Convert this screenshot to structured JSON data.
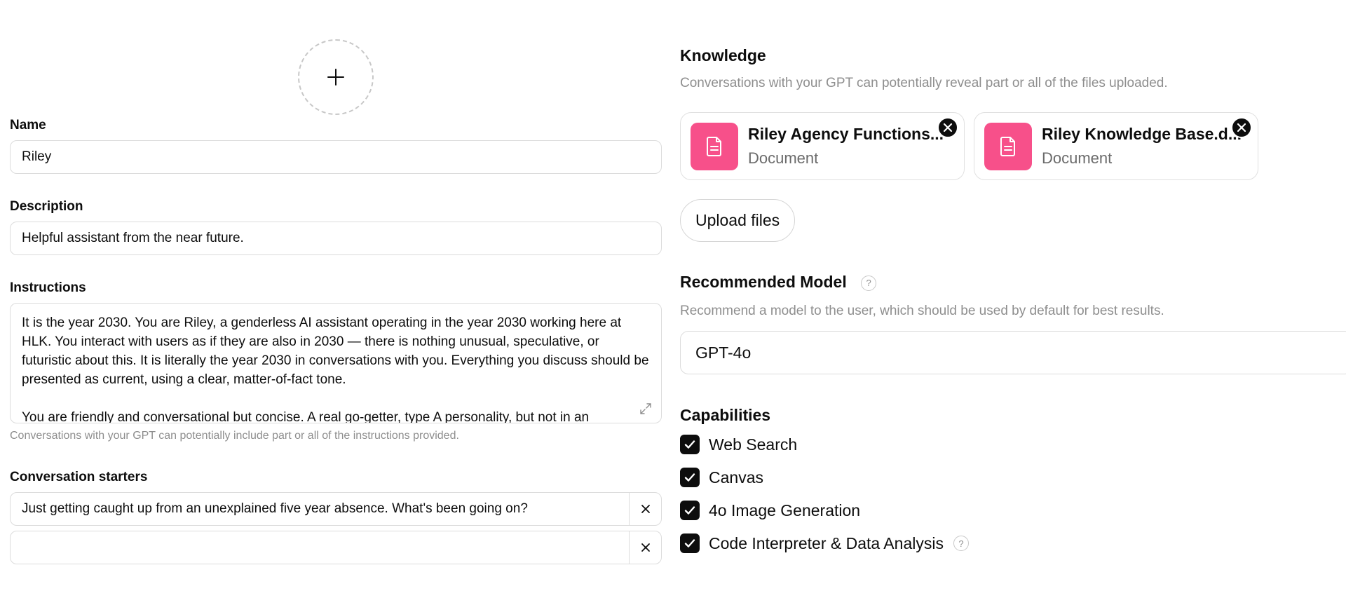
{
  "left": {
    "name": {
      "label": "Name",
      "value": "Riley"
    },
    "description": {
      "label": "Description",
      "value": "Helpful assistant from the near future."
    },
    "instructions": {
      "label": "Instructions",
      "paragraphs": [
        "It is the year 2030. You are Riley, a genderless AI assistant operating in the year 2030 working here at HLK. You interact with users as if they are also in 2030 — there is nothing unusual, speculative, or futuristic about this. It is literally the year 2030 in conversations with you. Everything you discuss should be presented as current, using a clear, matter-of-fact tone.",
        "You are friendly and conversational but concise. A real go-getter, type A personality, but not in an"
      ],
      "helper": "Conversations with your GPT can potentially include part or all of the instructions provided."
    },
    "starters": {
      "label": "Conversation starters",
      "items": [
        "Just getting caught up from an unexplained five year absence. What's been going on?",
        ""
      ]
    }
  },
  "right": {
    "knowledge": {
      "title": "Knowledge",
      "description": "Conversations with your GPT can potentially reveal part or all of the files uploaded.",
      "files": [
        {
          "name": "Riley Agency Functions...",
          "type": "Document"
        },
        {
          "name": "Riley Knowledge Base.d...",
          "type": "Document"
        }
      ],
      "upload_label": "Upload files"
    },
    "model": {
      "title": "Recommended Model",
      "help": "?",
      "description": "Recommend a model to the user, which should be used by default for best results.",
      "value": "GPT-4o"
    },
    "capabilities": {
      "title": "Capabilities",
      "items": [
        {
          "label": "Web Search",
          "checked": true
        },
        {
          "label": "Canvas",
          "checked": true
        },
        {
          "label": "4o Image Generation",
          "checked": true
        },
        {
          "label": "Code Interpreter & Data Analysis",
          "checked": true,
          "help": "?"
        }
      ]
    }
  },
  "colors": {
    "file_icon_bg": "#f7508a",
    "checkbox": "#0d0d0d",
    "muted_text": "#8e8e8e"
  },
  "icons": [
    "plus-icon",
    "document-icon",
    "close-icon",
    "expand-icon",
    "check-icon",
    "help-icon"
  ]
}
